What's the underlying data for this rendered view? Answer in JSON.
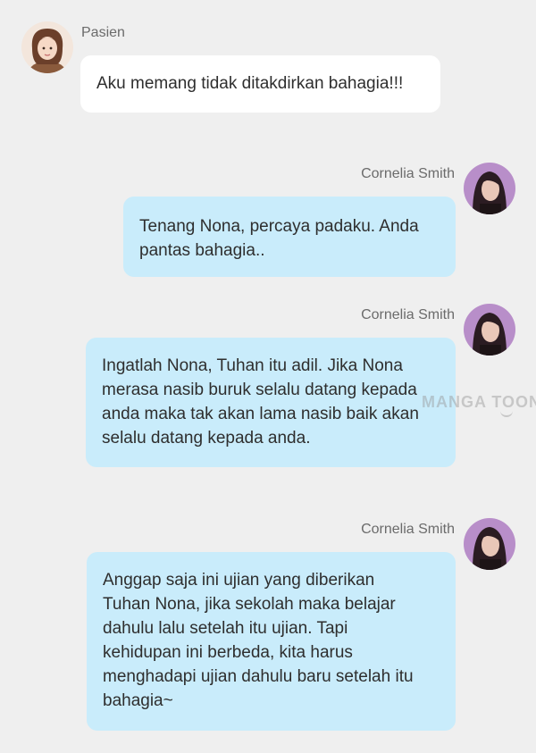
{
  "messages": [
    {
      "sender": "Pasien",
      "side": "left",
      "text": "Aku memang tidak ditakdirkan bahagia!!!"
    },
    {
      "sender": "Cornelia Smith",
      "side": "right",
      "text": "Tenang Nona, percaya padaku. Anda\npantas bahagia.."
    },
    {
      "sender": "Cornelia Smith",
      "side": "right",
      "text": "Ingatlah Nona, Tuhan itu adil. Jika Nona\nmerasa nasib buruk selalu datang kepada\nanda maka tak akan lama nasib baik akan\nselalu datang kepada anda."
    },
    {
      "sender": "Cornelia Smith",
      "side": "right",
      "text": "Anggap saja ini ujian yang diberikan\nTuhan Nona, jika sekolah maka belajar\ndahulu lalu setelah itu ujian. Tapi\nkehidupan ini berbeda, kita harus\nmenghadapi ujian dahulu baru setelah itu\nbahagia~"
    }
  ],
  "watermark": "MANGA TOON",
  "colors": {
    "background": "#efefef",
    "left_bubble": "#ffffff",
    "right_bubble": "#c9ecfb"
  }
}
